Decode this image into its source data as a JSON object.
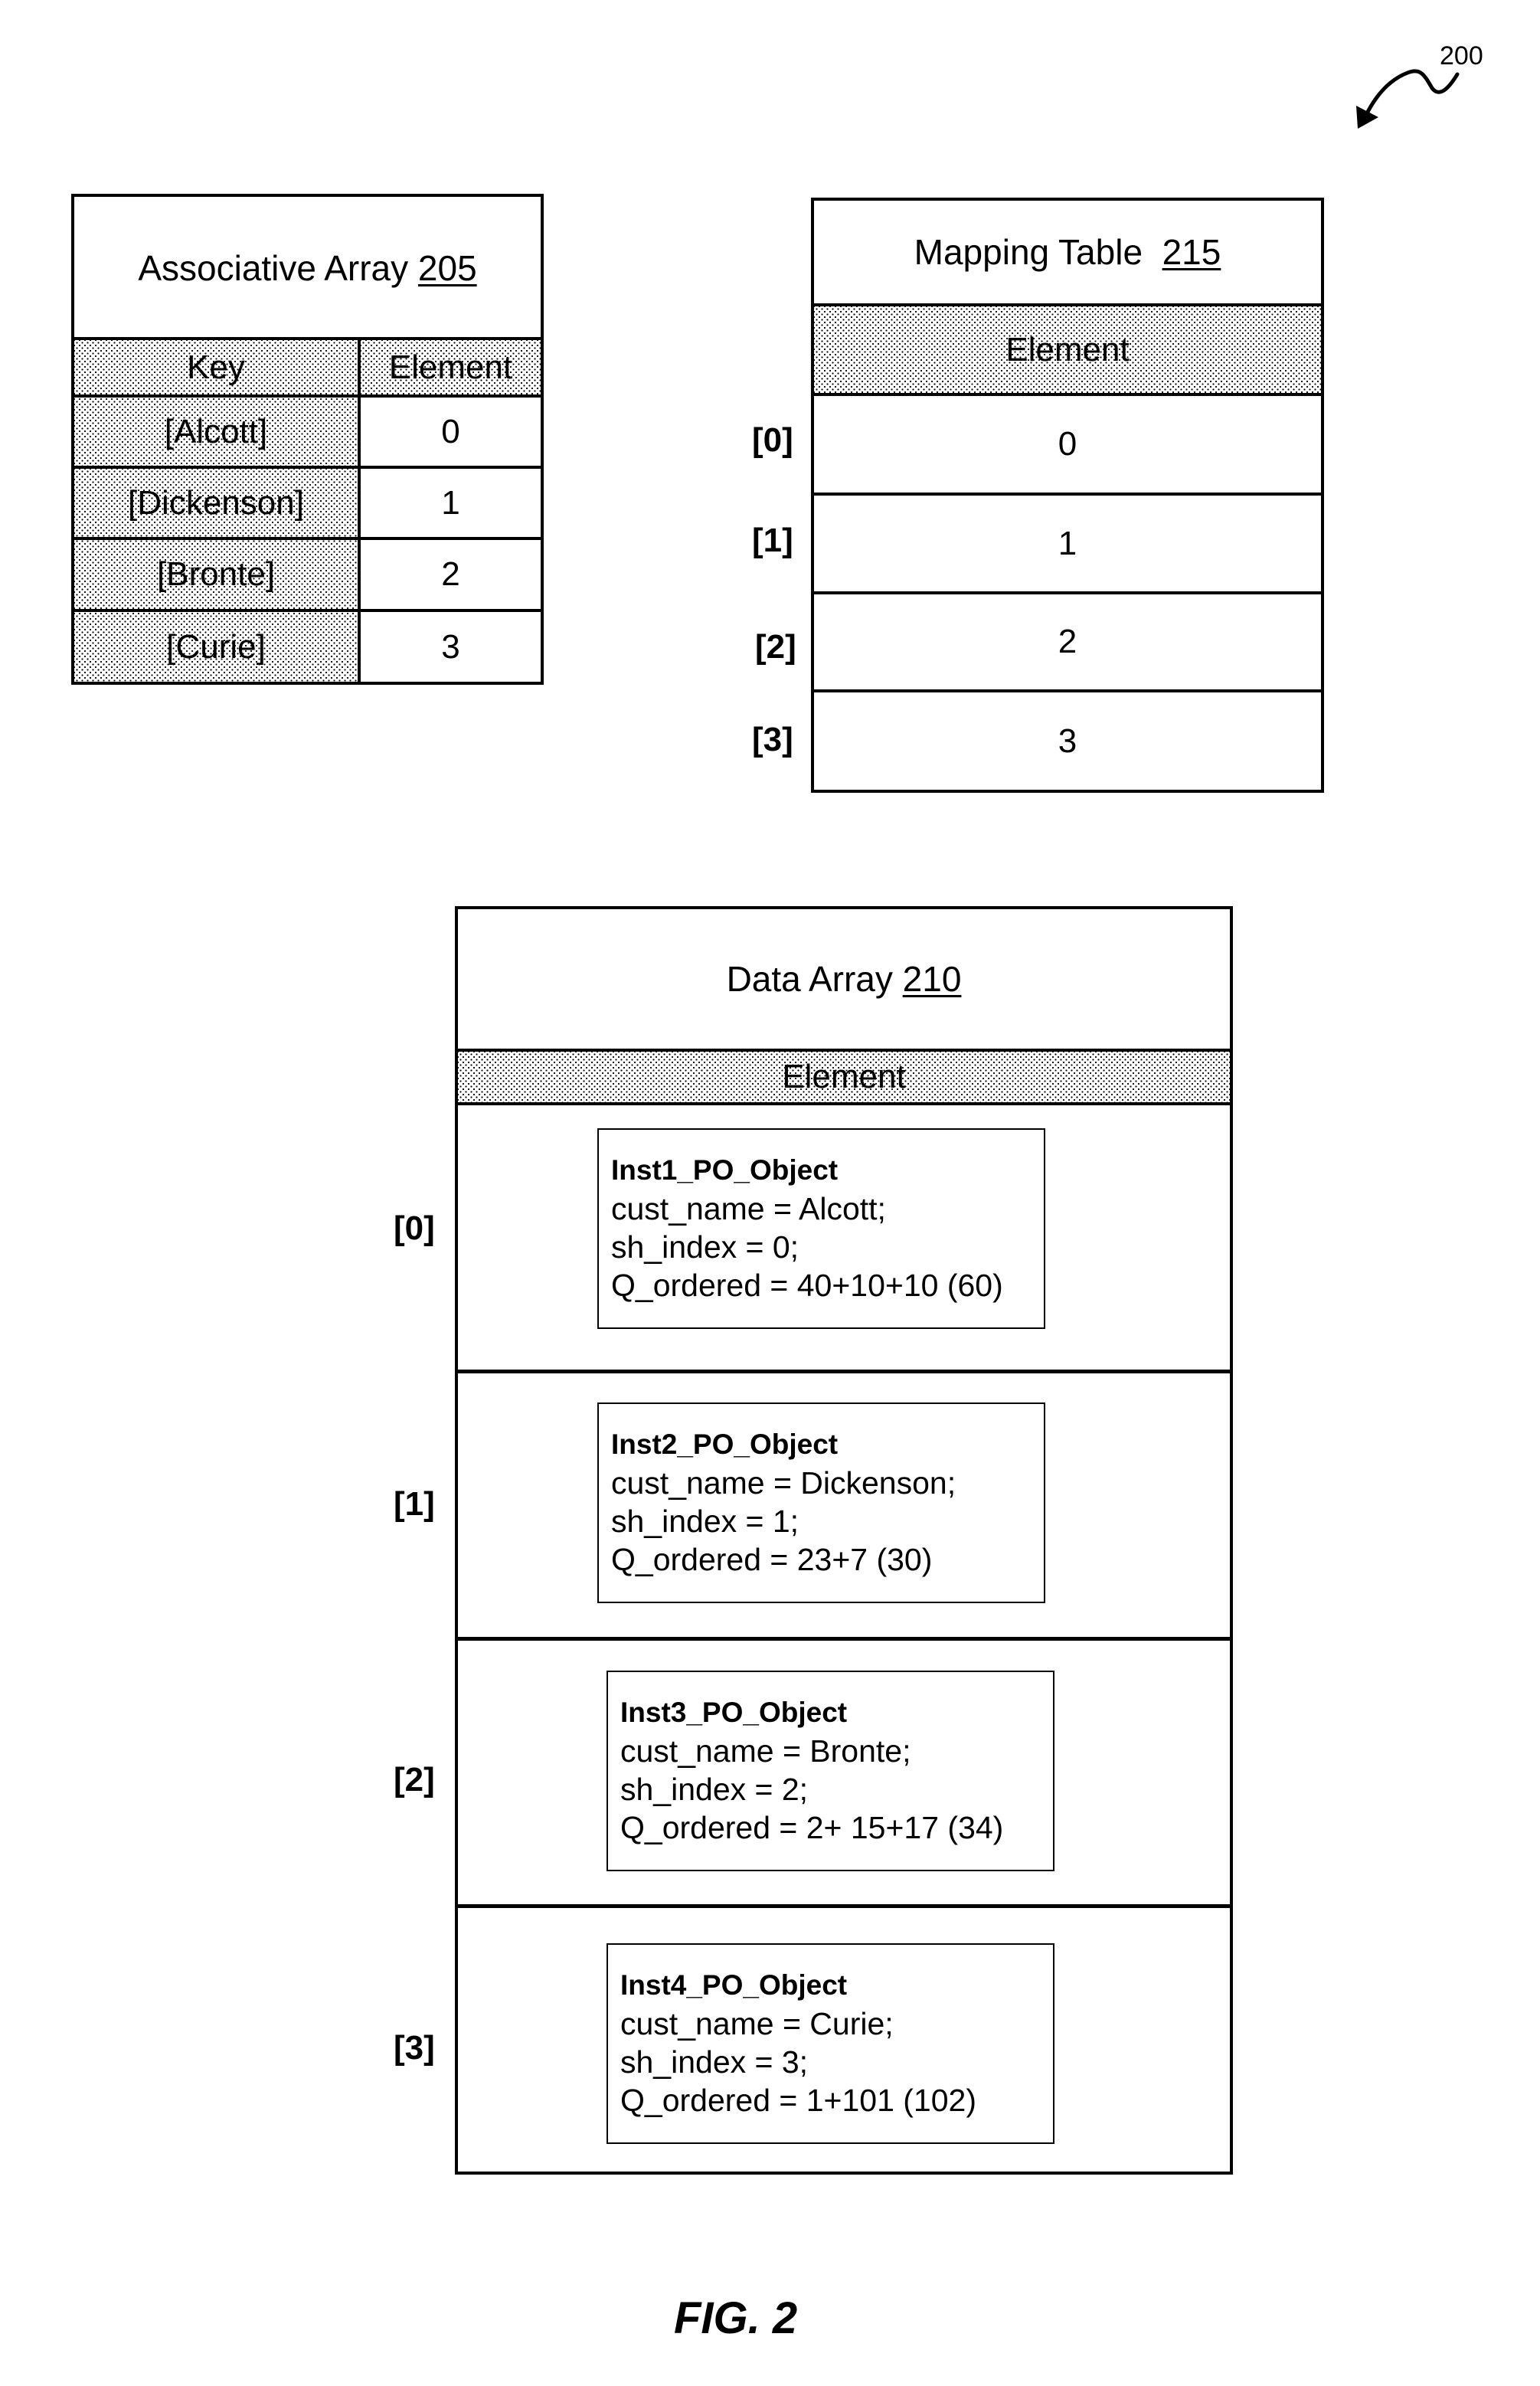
{
  "figure": {
    "reference_number": "200",
    "caption": "FIG. 2"
  },
  "associative_array": {
    "title": "Associative Array",
    "ref": "205",
    "headers": {
      "key": "Key",
      "element": "Element"
    },
    "rows": [
      {
        "key": "[Alcott]",
        "element": "0"
      },
      {
        "key": "[Dickenson]",
        "element": "1"
      },
      {
        "key": "[Bronte]",
        "element": "2"
      },
      {
        "key": "[Curie]",
        "element": "3"
      }
    ]
  },
  "mapping_table": {
    "title": "Mapping Table",
    "ref": "215",
    "header": "Element",
    "rows": [
      {
        "index": "[0]",
        "element": "0"
      },
      {
        "index": "[1]",
        "element": "1"
      },
      {
        "index": "[2]",
        "element": "2"
      },
      {
        "index": "[3]",
        "element": "3"
      }
    ]
  },
  "data_array": {
    "title": "Data Array",
    "ref": "210",
    "header": "Element",
    "rows": [
      {
        "index": "[0]",
        "object_name": "Inst1_PO_Object",
        "lines": [
          "cust_name = Alcott;",
          "sh_index = 0;",
          "Q_ordered = 40+10+10 (60)"
        ]
      },
      {
        "index": "[1]",
        "object_name": "Inst2_PO_Object",
        "lines": [
          "cust_name = Dickenson;",
          "sh_index = 1;",
          "Q_ordered = 23+7 (30)"
        ]
      },
      {
        "index": "[2]",
        "object_name": "Inst3_PO_Object",
        "lines": [
          "cust_name = Bronte;",
          "sh_index = 2;",
          "Q_ordered = 2+ 15+17 (34)"
        ]
      },
      {
        "index": "[3]",
        "object_name": "Inst4_PO_Object",
        "lines": [
          "cust_name = Curie;",
          "sh_index = 3;",
          "Q_ordered = 1+101 (102)"
        ]
      }
    ]
  }
}
